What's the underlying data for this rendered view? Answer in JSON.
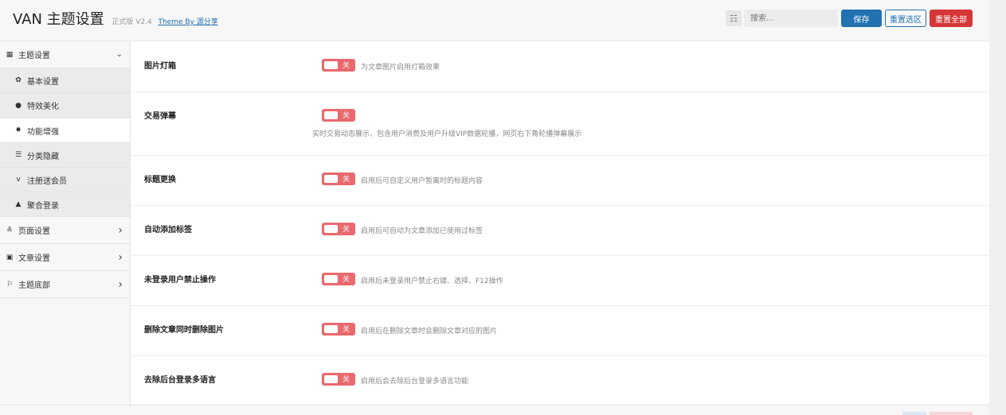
{
  "header": {
    "title": "VAN 主题设置",
    "version": "正式版 V2.4",
    "author": "Theme By 源分享",
    "search_placeholder": "搜索...",
    "save_label": "保存",
    "reset_section_label": "重置选区",
    "reset_all_label": "重置全部"
  },
  "sidebar": {
    "items": [
      {
        "label": "主题设置",
        "icon": "grid-icon",
        "glyph": "▦",
        "level": "top",
        "expanded": true
      },
      {
        "label": "基本设置",
        "icon": "gear-icon",
        "glyph": "✿",
        "level": "sub"
      },
      {
        "label": "特效美化",
        "icon": "circle-icon",
        "glyph": "●",
        "level": "sub"
      },
      {
        "label": "功能增强",
        "icon": "star-icon",
        "glyph": "✸",
        "level": "sub",
        "active": true
      },
      {
        "label": "分类隐藏",
        "icon": "menu-icon",
        "glyph": "☰",
        "level": "sub"
      },
      {
        "label": "注册送会员",
        "icon": "v-icon",
        "glyph": "v",
        "level": "sub"
      },
      {
        "label": "聚合登录",
        "icon": "bell-icon",
        "glyph": "▲",
        "level": "sub"
      },
      {
        "label": "页面设置",
        "icon": "sliders-icon",
        "glyph": "≛",
        "level": "top"
      },
      {
        "label": "文章设置",
        "icon": "doc-icon",
        "glyph": "▣",
        "level": "top"
      },
      {
        "label": "主题底部",
        "icon": "flag-icon",
        "glyph": "⚐",
        "level": "top"
      }
    ]
  },
  "settings": [
    {
      "title": "图片灯箱",
      "toggle_label": "关",
      "desc": "为文章图片启用灯箱效果"
    },
    {
      "title": "交易弹幕",
      "toggle_label": "关",
      "desc": "实时交易动态展示，包含用户消费及用户升级VIP数据轮播，网页右下角轮播弹幕展示"
    },
    {
      "title": "标题更换",
      "toggle_label": "关",
      "desc": "启用后可自定义用户暂离时的标题内容"
    },
    {
      "title": "自动添加标签",
      "toggle_label": "关",
      "desc": "启用后可自动为文章添加已使用过标签"
    },
    {
      "title": "未登录用户禁止操作",
      "toggle_label": "关",
      "desc": "启用后未登录用户禁止右键、选择、F12操作"
    },
    {
      "title": "删除文章同时删除图片",
      "toggle_label": "关",
      "desc": "启用后在删除文章时会删除文章对应的图片"
    },
    {
      "title": "去除后台登录多语言",
      "toggle_label": "关",
      "desc": "启用后会去除后台登录多语言功能"
    }
  ],
  "colors": {
    "primary": "#2271b1",
    "danger": "#d63638",
    "toggle_off": "#e9696d"
  }
}
